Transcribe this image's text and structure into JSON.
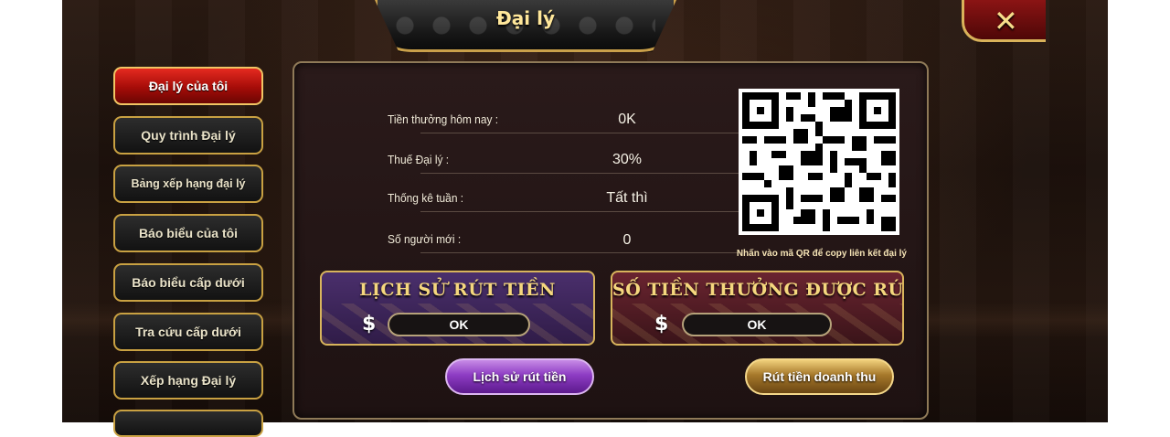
{
  "window": {
    "title": "Đại lý",
    "close_label": "✕"
  },
  "sidebar": {
    "items": [
      {
        "label": "Đại lý của tôi",
        "active": true
      },
      {
        "label": "Quy trình Đại lý"
      },
      {
        "label": "Bảng xếp hạng đại lý"
      },
      {
        "label": "Báo biểu của tôi"
      },
      {
        "label": "Báo biểu cấp dưới"
      },
      {
        "label": "Tra cứu cấp dưới"
      },
      {
        "label": "Xếp hạng Đại lý"
      }
    ]
  },
  "info": {
    "rows": [
      {
        "label": "Tiền thưởng hôm nay :",
        "value": "0K"
      },
      {
        "label": "Thuế Đại lý :",
        "value": "30%"
      },
      {
        "label": "Thống kê tuần :",
        "value": "Tất thì"
      },
      {
        "label": "Số người mới :",
        "value": "0"
      }
    ],
    "qr_hint": "Nhấn vào mã QR để copy liên kết đại lý"
  },
  "cards": {
    "withdraw_history": {
      "title": "LỊCH SỬ RÚT TIỀN",
      "currency_symbol": "$",
      "value": "OK"
    },
    "withdrawable_bonus": {
      "title": "SỐ TIỀN THƯỞNG ĐƯỢC RÚT",
      "currency_symbol": "$",
      "value": "OK"
    }
  },
  "actions": {
    "history_button": "Lịch sử rút tiền",
    "withdraw_button": "Rút tiền doanh thu"
  },
  "colors": {
    "accent_gold": "#d8b45c",
    "active_red": "#c8140e",
    "purple_card": "#4a2f6c",
    "maroon_card": "#6a2430"
  }
}
